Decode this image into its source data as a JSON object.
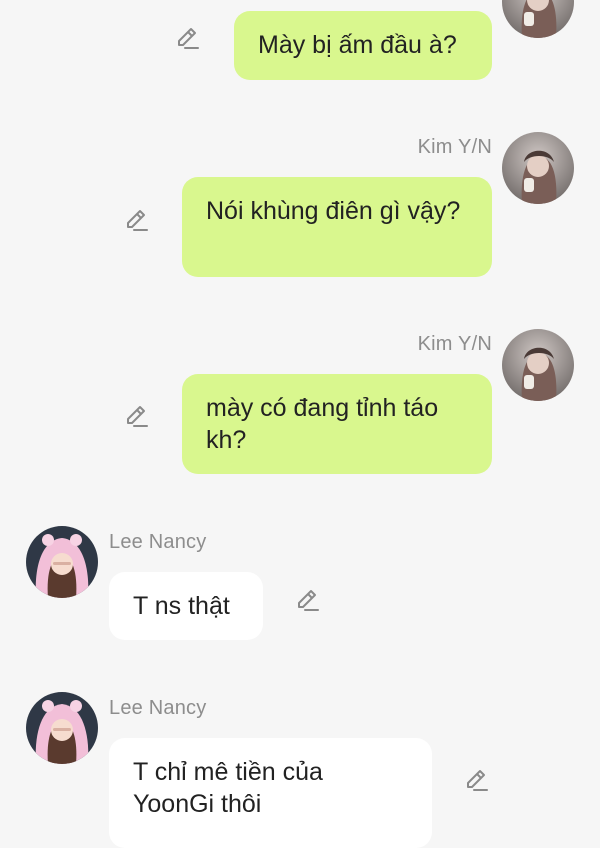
{
  "colors": {
    "background": "#f6f6f6",
    "outgoing_bubble": "#d9f78e",
    "incoming_bubble": "#ffffff",
    "name_text": "#8d8d8d",
    "message_text": "#222222",
    "edit_icon": "#8a8a8a"
  },
  "messages": [
    {
      "direction": "outgoing",
      "sender": "",
      "text": "Mày bị ấm đầu à?",
      "avatar_icon": "user-avatar-icon",
      "edit_icon": "pencil-edit-icon"
    },
    {
      "direction": "outgoing",
      "sender": "Kim Y/N",
      "text": "Nói khùng điên gì vậy?",
      "avatar_icon": "user-avatar-icon",
      "edit_icon": "pencil-edit-icon"
    },
    {
      "direction": "outgoing",
      "sender": "Kim Y/N",
      "text": "mày có đang tỉnh táo kh?",
      "avatar_icon": "user-avatar-icon",
      "edit_icon": "pencil-edit-icon"
    },
    {
      "direction": "incoming",
      "sender": "Lee Nancy",
      "text": "T ns thật",
      "avatar_icon": "contact-avatar-icon",
      "edit_icon": "pencil-edit-icon"
    },
    {
      "direction": "incoming",
      "sender": "Lee Nancy",
      "text": "T chỉ mê tiền của YoonGi thôi",
      "avatar_icon": "contact-avatar-icon",
      "edit_icon": "pencil-edit-icon"
    }
  ]
}
